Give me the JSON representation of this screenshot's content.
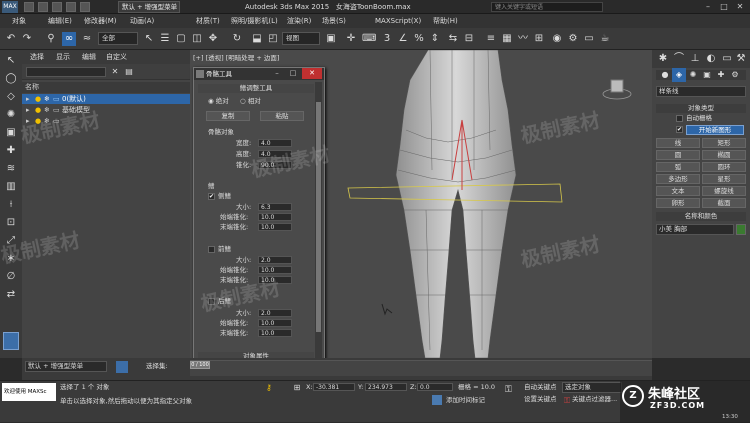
{
  "title_bar": {
    "logo": "MAX",
    "workspace_tab": "默认 + 增强型菜单",
    "app_title": "Autodesk 3ds Max 2015",
    "file_name": "女海盗ToonBoom.max",
    "search_placeholder": "键入关键字或短语"
  },
  "menu": [
    "对象(O)",
    "编辑(E)",
    "工具(T)",
    "组(G)",
    "视图(V)",
    "创建(C)",
    "修改器(M)",
    "动画(A)",
    "图形编辑器(D)",
    "渲染(R)",
    "自定义(U)",
    "脚本(S)",
    "帮助(H)"
  ],
  "menu_visible": [
    "对象",
    "编辑(E)",
    "修改器(M)",
    "动画(A)",
    "材质(T)",
    "照明/摄影机(L)",
    "渲染(R)",
    "场景(S)",
    "MAXScript(X)",
    "帮助(H)"
  ],
  "toolbar": {
    "selection_filter": "全部",
    "ref_coord": "视图"
  },
  "scene_explorer": {
    "menu": [
      "选择",
      "显示",
      "编辑",
      "自定义"
    ],
    "column_header": "名称",
    "rows": [
      {
        "label": "0(默认)",
        "selected": true
      },
      {
        "label": "基础模型",
        "selected": false
      },
      {
        "label": "",
        "selected": false
      }
    ],
    "workspace_label": "默认 + 增强型菜单",
    "select_set_label": "选择集:"
  },
  "viewport": {
    "label": "[+] [透视] [明暗处理 + 边面]"
  },
  "command_panel": {
    "dropdown": "样条线",
    "object_type_header": "对象类型",
    "auto_grid": "自动栅格",
    "start_new_shape": "开始新图形",
    "buttons": [
      "线",
      "矩形",
      "圆",
      "椭圆",
      "弧",
      "圆环",
      "多边形",
      "星形",
      "文本",
      "螺旋线",
      "卵形",
      "截面"
    ],
    "name_color_header": "名称和颜色",
    "object_name": "小美 胸部"
  },
  "bevel_dialog": {
    "title": "骨骼工具",
    "section_title": "鳍调整工具",
    "absolute": "绝对",
    "relative": "相对",
    "copy": "复制",
    "paste": "粘贴",
    "bone_object_header": "骨骼对象",
    "width_label": "宽度:",
    "width": "4.0",
    "height_label": "高度:",
    "height": "4.0",
    "taper_label": "锥化:",
    "taper": "90.0",
    "fins_header": "鳍",
    "side_fins": "侧鳍",
    "front_fin": "前鳍",
    "back_fin": "后鳍",
    "size_label": "大小:",
    "start_taper_label": "始端锥化:",
    "end_taper_label": "末端锥化:",
    "side": {
      "size": "6.3",
      "start": "10.0",
      "end": "10.0"
    },
    "front": {
      "size": "2.0",
      "start": "10.0",
      "end": "10.0"
    },
    "back": {
      "size": "2.0",
      "start": "10.0",
      "end": "10.0"
    },
    "object_props": "对象属性"
  },
  "status": {
    "selected": "选择了 1 个 对象",
    "hint": "单击以选择对象,然后拖动以便为其指定父对象",
    "welcome": "欢迎使用 MAXSc",
    "x_label": "X:",
    "x": "-30.381",
    "y_label": "Y:",
    "y": "234.973",
    "z_label": "Z:",
    "z": "0.0",
    "grid": "栅格 = 10.0",
    "auto_key": "自动关键点",
    "set_key": "设置关键点",
    "selected_obj": "选定对象",
    "key_filter": "关键点过滤器...",
    "add_time_tag": "添加时间标记",
    "frames": "0 / 100",
    "time": "13:30"
  },
  "watermark": [
    "极制素材",
    "极制素材",
    "极制素材",
    "极制素材",
    "极制素材",
    "极制素材"
  ],
  "brand": {
    "name": "朱峰社区",
    "url": "ZF3D.COM"
  }
}
